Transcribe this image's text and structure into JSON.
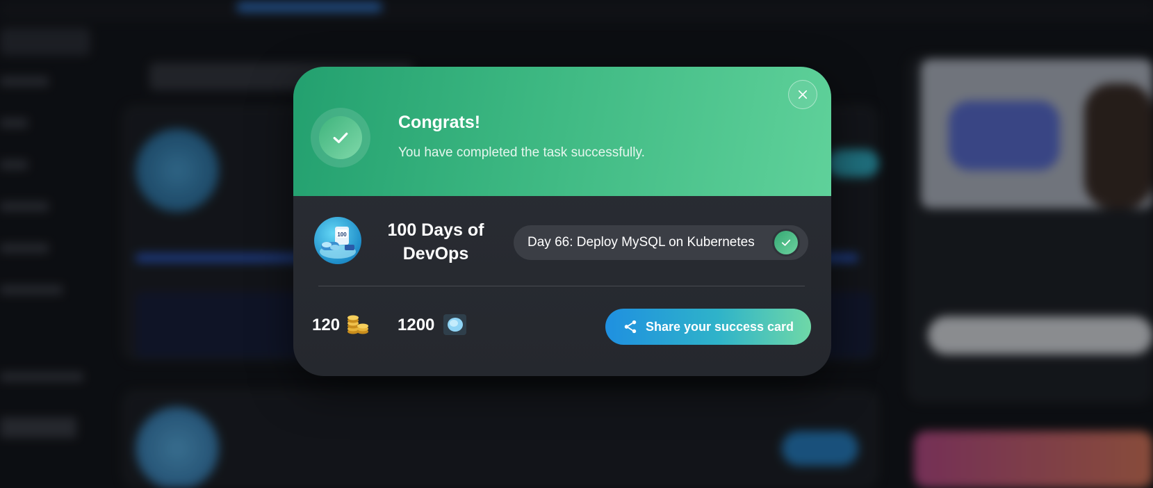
{
  "modal": {
    "title": "Congrats!",
    "subtitle": "You have completed the task successfully."
  },
  "course": {
    "title": "100 Days of DevOps",
    "icon_badge": "100"
  },
  "task": {
    "label": "Day 66: Deploy MySQL on Kubernetes"
  },
  "rewards": {
    "coins": "120",
    "gems": "1200"
  },
  "share": {
    "label": "Share your success card"
  },
  "colors": {
    "header_green": "#3db882",
    "share_gradient_start": "#1f90e0",
    "share_gradient_end": "#6fd8a7",
    "modal_bg": "#2b2e35"
  }
}
